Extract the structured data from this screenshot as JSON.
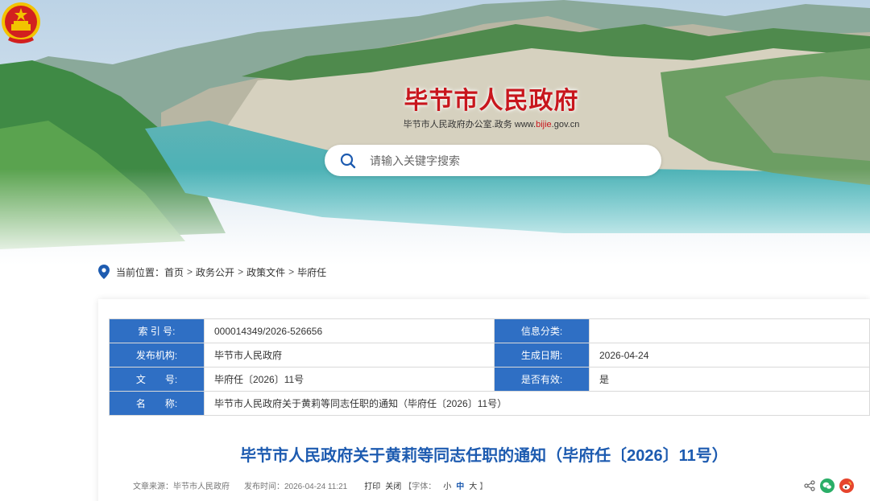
{
  "header": {
    "site_title": "毕节市人民政府",
    "site_sub_prefix": "毕节市人民政府办公室.政务 www.",
    "site_sub_domain": "bijie",
    "site_sub_suffix": ".gov.cn"
  },
  "search": {
    "placeholder": "请输入关键字搜索"
  },
  "breadcrumb": {
    "label": "当前位置：",
    "items": [
      "首页",
      "政务公开",
      "政策文件",
      "毕府任"
    ],
    "separator": ">"
  },
  "info_table": {
    "index_label": "索 引 号:",
    "index_value": "000014349/2026-526656",
    "category_label": "信息分类:",
    "category_value": "",
    "publisher_label": "发布机构:",
    "publisher_value": "毕节市人民政府",
    "date_label": "生成日期:",
    "date_value": "2026-04-24",
    "docno_label": "文　　号:",
    "docno_value": "毕府任〔2026〕11号",
    "valid_label": "是否有效:",
    "valid_value": "是",
    "name_label": "名　　称:",
    "name_value": "毕节市人民政府关于黄莉等同志任职的通知（毕府任〔2026〕11号）"
  },
  "article": {
    "title": "毕节市人民政府关于黄莉等同志任职的通知（毕府任〔2026〕11号）",
    "source": "文章来源：毕节市人民政府",
    "publish_time": "发布时间：2026-04-24 11:21",
    "print_label": "打印",
    "close_label": "关闭",
    "font_label_open": "【字体：",
    "font_small": "小",
    "font_medium": "中",
    "font_large": "大",
    "font_label_close": "】"
  },
  "colors": {
    "label_bg": "#2f6fc4",
    "title_blue": "#1d5bb0",
    "brand_red": "#c8161d"
  }
}
